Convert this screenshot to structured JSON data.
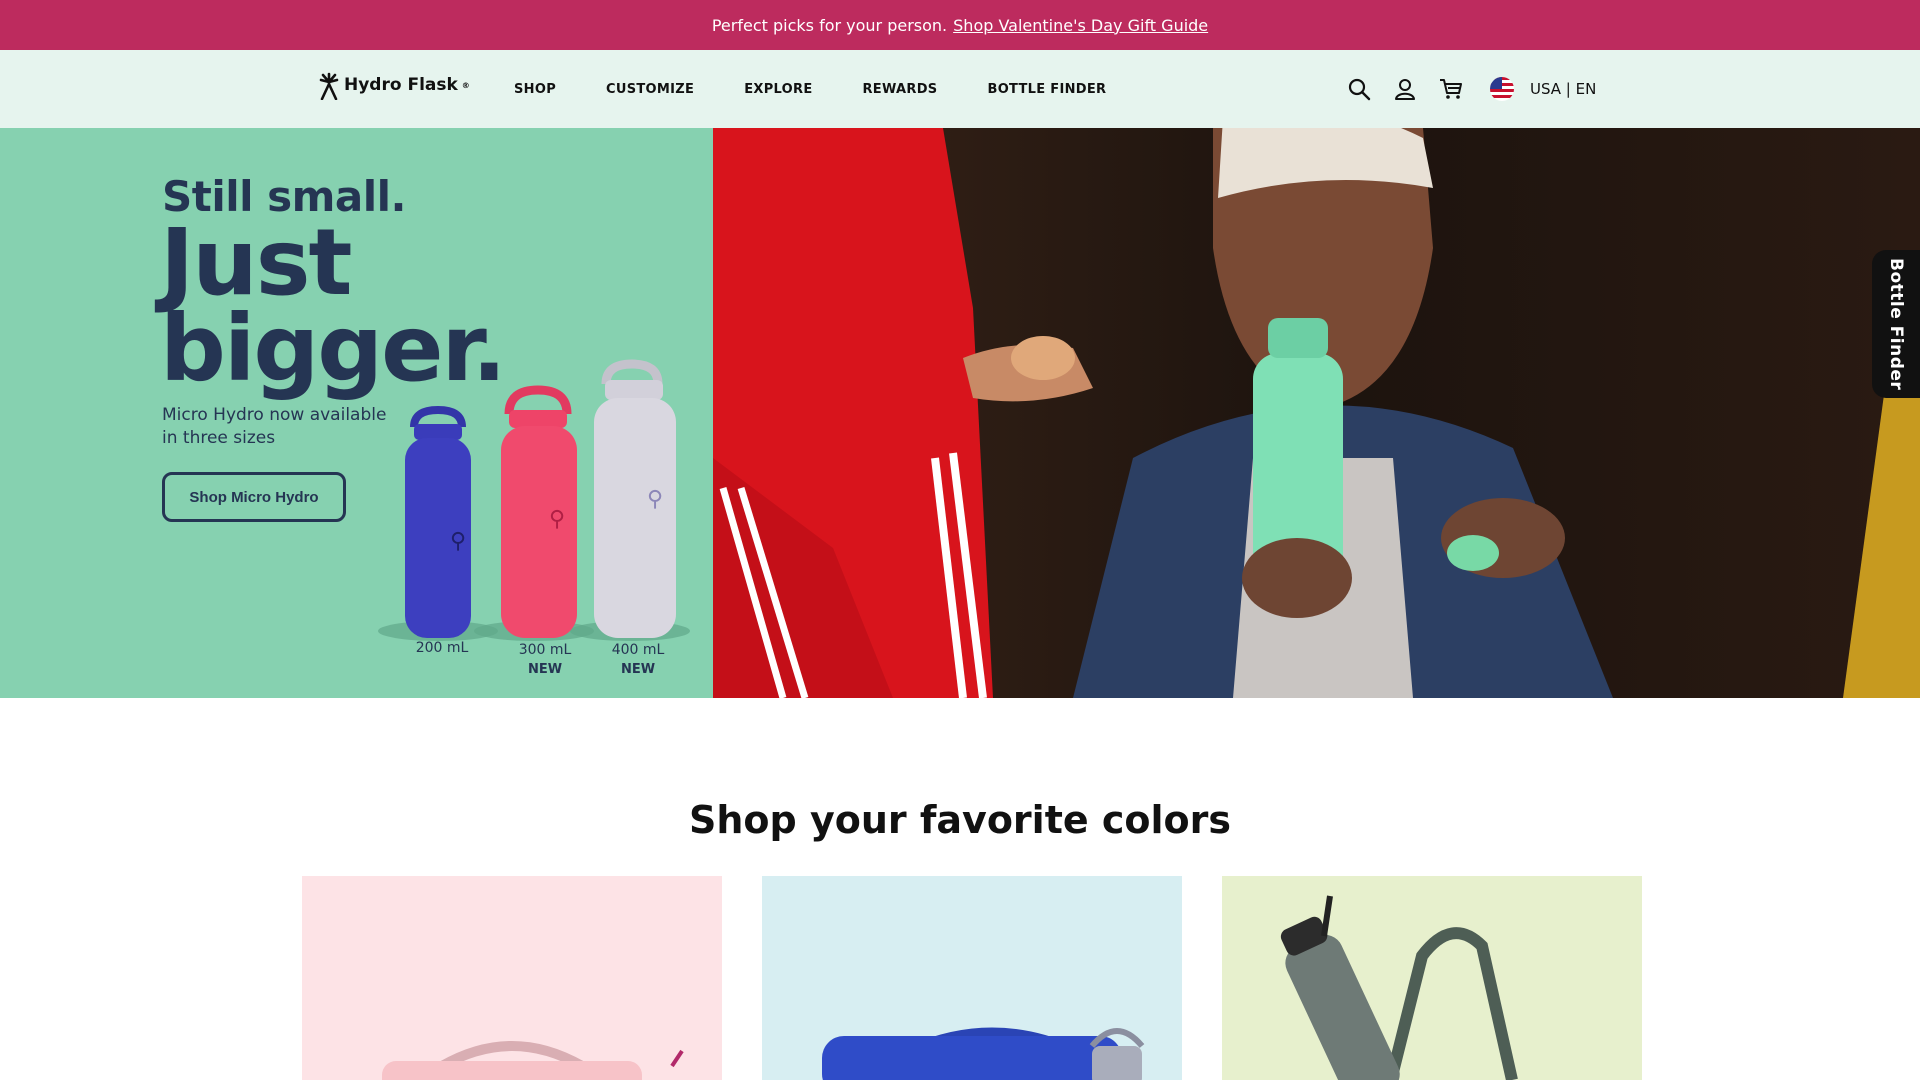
{
  "promo": {
    "text": "Perfect picks for your person.",
    "link": "Shop Valentine's Day Gift Guide"
  },
  "header": {
    "logo_text": "Hydro Flask",
    "logo_mark": "®",
    "nav": [
      "SHOP",
      "CUSTOMIZE",
      "EXPLORE",
      "REWARDS",
      "BOTTLE FINDER"
    ],
    "icons": [
      "search-icon",
      "account-icon",
      "cart-icon"
    ],
    "locale": "USA | EN"
  },
  "hero": {
    "kicker": "Still small.",
    "title": "Just\nbigger.",
    "subtitle": "Micro Hydro now available in three sizes",
    "cta": "Shop Micro Hydro",
    "bottles": [
      {
        "size": "200 mL",
        "badge": "",
        "color": "#3d3fbf"
      },
      {
        "size": "300 mL",
        "badge": "NEW",
        "color": "#f04a6d"
      },
      {
        "size": "400 mL",
        "badge": "NEW",
        "color": "#d9d7e0"
      }
    ]
  },
  "side_tab": "Bottle Finder",
  "section": {
    "title": "Shop your favorite colors",
    "cards": [
      {
        "bg": "#fde3e6",
        "product": "lunch-box"
      },
      {
        "bg": "#d7eef2",
        "product": "cooler-bag"
      },
      {
        "bg": "#e7f0cd",
        "product": "bottle-sling"
      }
    ]
  }
}
